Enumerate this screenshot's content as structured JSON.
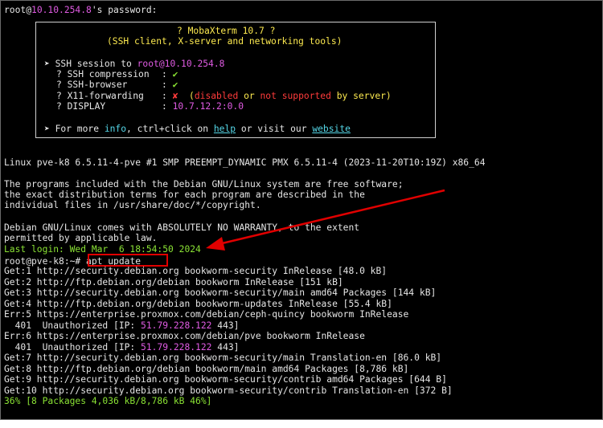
{
  "password_prompt": {
    "user": "root@",
    "host": "10.10.254.8",
    "suffix": "'s password:"
  },
  "banner": {
    "title": "? MobaXterm 10.7 ?",
    "subtitle": "(SSH client, X-server and networking tools)",
    "ssh_session": {
      "bullet": "➤ SSH session to ",
      "user": "root",
      "host": "@10.10.254.8"
    },
    "rows": [
      {
        "label": "? SSH compression",
        "value": "✔"
      },
      {
        "label": "? SSH-browser",
        "value": "✔"
      },
      {
        "label": "? X11-forwarding",
        "value": "✘"
      },
      {
        "label": "? DISPLAY",
        "value": "10.7.12.2:0.0"
      }
    ],
    "x11_note": {
      "open": "(",
      "disabled": "disabled",
      "or": " or ",
      "not_supported": "not supported",
      "tail": " by server)"
    },
    "footer": {
      "lead": "➤ For more ",
      "info": "info",
      "mid": ", ctrl+click on ",
      "help": "help",
      "or_visit": " or visit our ",
      "website": "website"
    }
  },
  "motd": [
    "Linux pve-k8 6.5.11-4-pve #1 SMP PREEMPT_DYNAMIC PMX 6.5.11-4 (2023-11-20T10:19Z) x86_64",
    "",
    "The programs included with the Debian GNU/Linux system are free software;",
    "the exact distribution terms for each program are described in the",
    "individual files in /usr/share/doc/*/copyright.",
    "",
    "Debian GNU/Linux comes with ABSOLUTELY NO WARRANTY, to the extent",
    "permitted by applicable law."
  ],
  "last_login": "Last login: Wed Mar  6 18:54:50 2024",
  "prompt": "root@pve-k8:~# ",
  "command": "apt update",
  "apt_output": {
    "get1": "Get:1 http://security.debian.org bookworm-security InRelease [48.0 kB]",
    "get2": "Get:2 http://ftp.debian.org/debian bookworm InRelease [151 kB]",
    "get3": "Get:3 http://security.debian.org bookworm-security/main amd64 Packages [144 kB]",
    "get4": "Get:4 http://ftp.debian.org/debian bookworm-updates InRelease [55.4 kB]",
    "err5": "Err:5 https://enterprise.proxmox.com/debian/ceph-quincy bookworm InRelease",
    "unauth_prefix": "  401  Unauthorized [IP: ",
    "unauth_ip": "51.79.228.122",
    "unauth_port": " 443]",
    "err6": "Err:6 https://enterprise.proxmox.com/debian/pve bookworm InRelease",
    "get7": "Get:7 http://security.debian.org bookworm-security/main Translation-en [86.0 kB]",
    "get8": "Get:8 http://ftp.debian.org/debian bookworm/main amd64 Packages [8,786 kB]",
    "get9": "Get:9 http://security.debian.org bookworm-security/contrib amd64 Packages [644 B]",
    "get10": "Get:10 http://security.debian.org bookworm-security/contrib Translation-en [372 B]"
  },
  "progress_line": "36% [8 Packages 4,036 kB/8,786 kB 46%]",
  "colors": {
    "terminal_bg": "#000000",
    "text": "#e6e6e6",
    "green": "#8ae234",
    "yellow": "#fce94f",
    "cyan": "#55d7e8",
    "magenta": "#e05be3",
    "red": "#ff3b3b",
    "annotation_red": "#e00000"
  }
}
